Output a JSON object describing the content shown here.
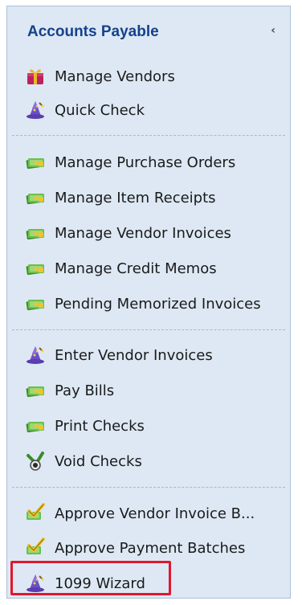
{
  "panel": {
    "title": "Accounts Payable",
    "collapse_glyph": "‹"
  },
  "groups": [
    {
      "items": [
        {
          "label": "Manage Vendors",
          "icon": "vendor-gift-icon"
        },
        {
          "label": "Quick Check",
          "icon": "wizard-icon"
        }
      ]
    },
    {
      "items": [
        {
          "label": "Manage Purchase Orders",
          "icon": "money-icon"
        },
        {
          "label": "Manage Item Receipts",
          "icon": "money-icon"
        },
        {
          "label": "Manage Vendor Invoices",
          "icon": "money-icon"
        },
        {
          "label": "Manage Credit Memos",
          "icon": "money-icon"
        },
        {
          "label": "Pending Memorized Invoices",
          "icon": "money-icon"
        }
      ]
    },
    {
      "items": [
        {
          "label": "Enter Vendor Invoices",
          "icon": "wizard-icon"
        },
        {
          "label": "Pay Bills",
          "icon": "money-icon"
        },
        {
          "label": "Print Checks",
          "icon": "money-icon"
        },
        {
          "label": "Void Checks",
          "icon": "void-check-icon"
        }
      ]
    },
    {
      "items": [
        {
          "label": "Approve Vendor Invoice B...",
          "icon": "approve-check-icon"
        },
        {
          "label": "Approve Payment Batches",
          "icon": "approve-check-icon"
        },
        {
          "label": "1099 Wizard",
          "icon": "wizard-icon",
          "highlighted": true
        }
      ]
    }
  ],
  "colors": {
    "panel_bg": "#dde8f4",
    "title": "#15428b",
    "highlight_border": "#e0182d"
  }
}
